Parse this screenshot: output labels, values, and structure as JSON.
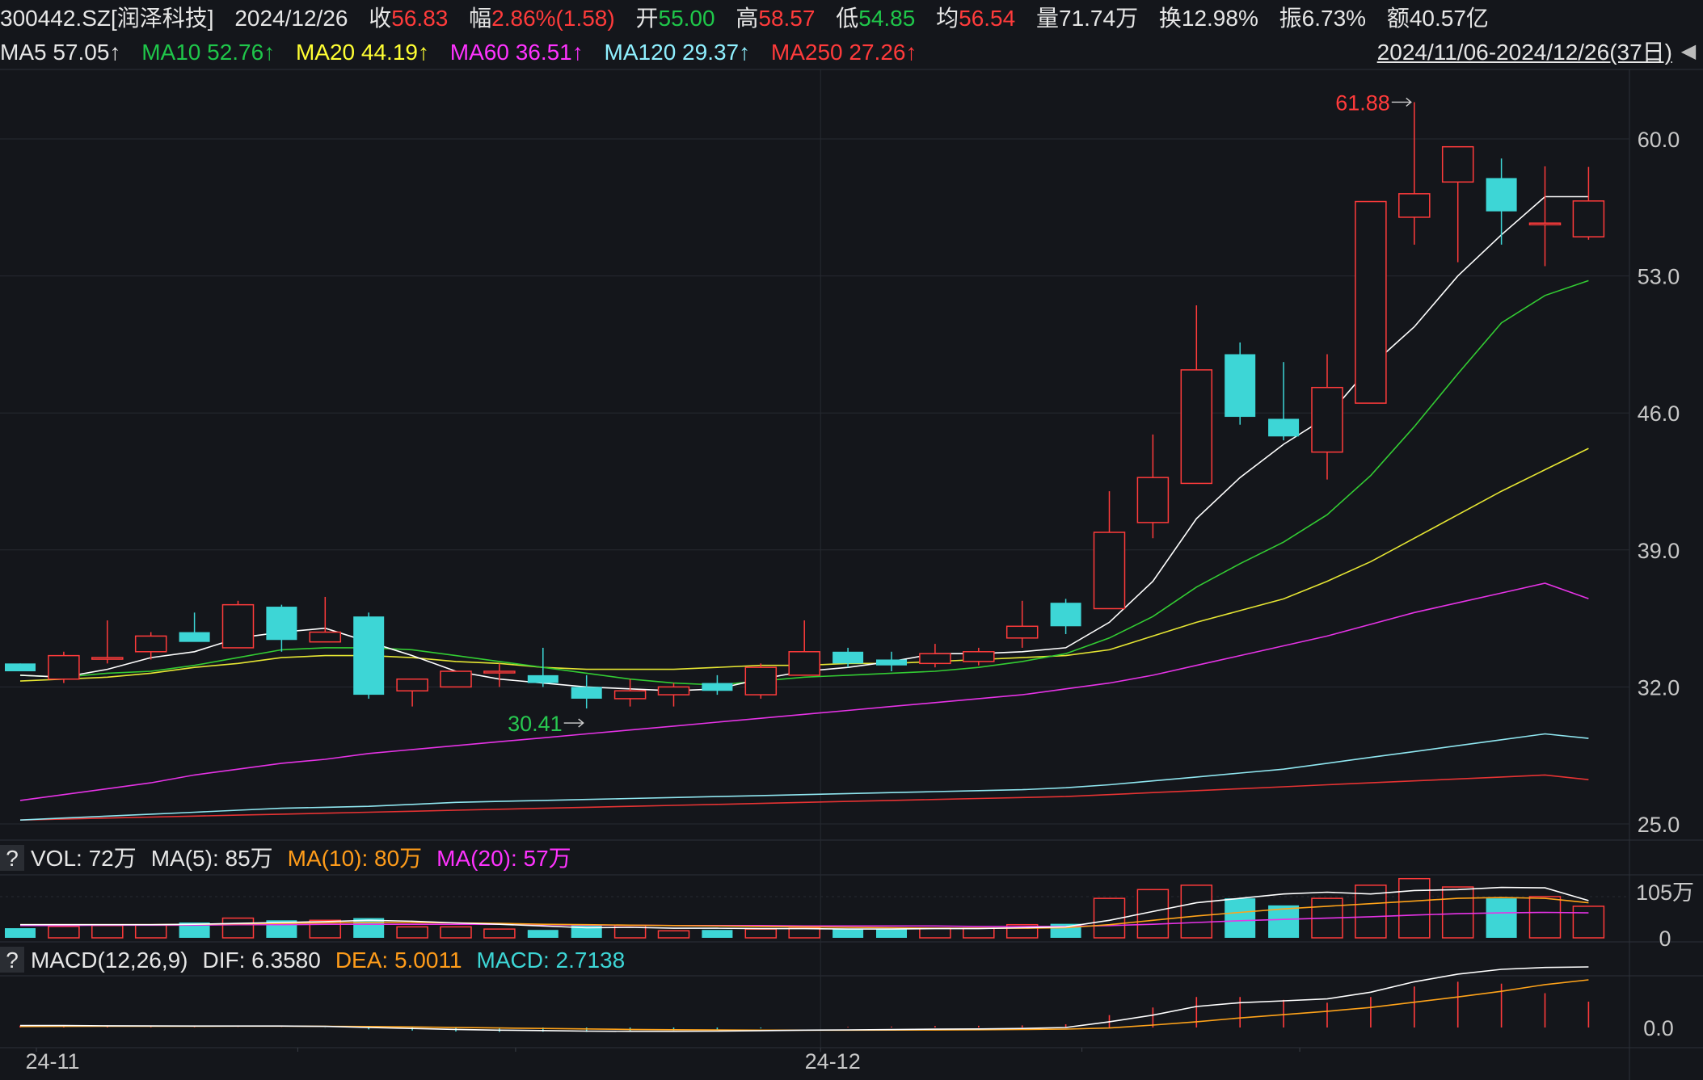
{
  "header": {
    "symbol": "300442.SZ[润泽科技]",
    "date": "2024/12/26",
    "close_label": "收",
    "close_value": "56.83",
    "change_label": "幅",
    "change_value": "2.86%(1.58)",
    "open_label": "开",
    "open_value": "55.00",
    "high_label": "高",
    "high_value": "58.57",
    "low_label": "低",
    "low_value": "54.85",
    "avg_label": "均",
    "avg_value": "56.54",
    "volume_label": "量",
    "volume_value": "71.74万",
    "turnover_label": "换",
    "turnover_value": "12.98%",
    "amplitude_label": "振",
    "amplitude_value": "6.73%",
    "amount_label": "额",
    "amount_value": "40.57亿"
  },
  "ma_legend": {
    "ma5": "MA5 57.05↑",
    "ma10": "MA10 52.76↑",
    "ma20": "MA20 44.19↑",
    "ma60": "MA60 36.51↑",
    "ma120": "MA120 29.37↑",
    "ma250": "MA250 27.26↑"
  },
  "range_label": "2024/11/06-2024/12/26(37日)",
  "range_button_icon": "triangle-left-icon",
  "vol_legend": {
    "question": "?",
    "vol": "VOL: 72万",
    "ma5": "MA(5): 85万",
    "ma10": "MA(10): 80万",
    "ma20": "MA(20): 57万"
  },
  "macd_legend": {
    "question": "?",
    "name": "MACD(12,26,9)",
    "dif": "DIF: 6.3580",
    "dea": "DEA: 5.0011",
    "macd": "MACD: 2.7138"
  },
  "colors": {
    "background": "#14161b",
    "up": "#ff3b3b",
    "down": "#3dd6d6",
    "ma5": "#ffffff",
    "ma10": "#33cc33",
    "ma20": "#e6e633",
    "ma60": "#e633e6",
    "ma120": "#8fe6f0",
    "ma250": "#e63333",
    "dif": "#ffffff",
    "dea": "#ffa31a"
  },
  "chart_data": {
    "type": "candlestick",
    "price_axis": {
      "ticks": [
        "60.0",
        "53.0",
        "46.0",
        "39.0",
        "32.0",
        "25.0"
      ]
    },
    "volume_axis": {
      "ticks": [
        "105万",
        "0"
      ]
    },
    "macd_axis": {
      "ticks": [
        "0.0"
      ]
    },
    "x_ticks": [
      "24-11",
      "24-12"
    ],
    "annotations": {
      "high": "61.88",
      "low": "30.41"
    },
    "candles": [
      {
        "o": 33.2,
        "h": 33.2,
        "l": 32.8,
        "c": 32.8
      },
      {
        "o": 32.4,
        "h": 33.8,
        "l": 32.2,
        "c": 33.6
      },
      {
        "o": 33.5,
        "h": 35.4,
        "l": 33.2,
        "c": 33.5
      },
      {
        "o": 33.8,
        "h": 34.8,
        "l": 33.4,
        "c": 34.6
      },
      {
        "o": 34.8,
        "h": 35.8,
        "l": 34.4,
        "c": 34.3
      },
      {
        "o": 34.0,
        "h": 36.4,
        "l": 34.0,
        "c": 36.2
      },
      {
        "o": 36.1,
        "h": 36.2,
        "l": 33.8,
        "c": 34.4
      },
      {
        "o": 34.3,
        "h": 36.6,
        "l": 34.3,
        "c": 34.8
      },
      {
        "o": 35.6,
        "h": 35.8,
        "l": 31.4,
        "c": 31.6
      },
      {
        "o": 31.8,
        "h": 32.4,
        "l": 31.0,
        "c": 32.4
      },
      {
        "o": 32.0,
        "h": 32.8,
        "l": 32.0,
        "c": 32.8
      },
      {
        "o": 32.8,
        "h": 33.2,
        "l": 32.0,
        "c": 32.8
      },
      {
        "o": 32.6,
        "h": 34.0,
        "l": 32.0,
        "c": 32.2
      },
      {
        "o": 32.0,
        "h": 32.6,
        "l": 30.9,
        "c": 31.4
      },
      {
        "o": 31.4,
        "h": 32.4,
        "l": 31.0,
        "c": 31.8
      },
      {
        "o": 31.6,
        "h": 32.2,
        "l": 31.0,
        "c": 32.0
      },
      {
        "o": 32.2,
        "h": 32.6,
        "l": 31.6,
        "c": 31.8
      },
      {
        "o": 31.6,
        "h": 33.2,
        "l": 31.4,
        "c": 33.0
      },
      {
        "o": 32.6,
        "h": 35.4,
        "l": 32.6,
        "c": 33.8
      },
      {
        "o": 33.8,
        "h": 34.0,
        "l": 33.0,
        "c": 33.2
      },
      {
        "o": 33.4,
        "h": 33.8,
        "l": 32.8,
        "c": 33.1
      },
      {
        "o": 33.2,
        "h": 34.2,
        "l": 33.0,
        "c": 33.7
      },
      {
        "o": 33.3,
        "h": 34.0,
        "l": 33.1,
        "c": 33.8
      },
      {
        "o": 34.5,
        "h": 36.4,
        "l": 34.0,
        "c": 35.1
      },
      {
        "o": 36.3,
        "h": 36.5,
        "l": 34.7,
        "c": 35.1
      },
      {
        "o": 36.0,
        "h": 42.0,
        "l": 36.0,
        "c": 39.9
      },
      {
        "o": 40.4,
        "h": 44.9,
        "l": 39.6,
        "c": 42.7
      },
      {
        "o": 42.4,
        "h": 51.5,
        "l": 42.4,
        "c": 48.2
      },
      {
        "o": 49.0,
        "h": 49.6,
        "l": 45.4,
        "c": 45.8
      },
      {
        "o": 45.7,
        "h": 48.6,
        "l": 44.6,
        "c": 44.8
      },
      {
        "o": 44.0,
        "h": 49.0,
        "l": 42.6,
        "c": 47.3
      },
      {
        "o": 46.5,
        "h": 56.8,
        "l": 46.5,
        "c": 56.8
      },
      {
        "o": 56.0,
        "h": 61.88,
        "l": 54.6,
        "c": 57.2
      },
      {
        "o": 57.8,
        "h": 59.4,
        "l": 53.7,
        "c": 59.6
      },
      {
        "o": 58.0,
        "h": 59.0,
        "l": 54.6,
        "c": 56.3
      },
      {
        "o": 55.7,
        "h": 58.6,
        "l": 53.5,
        "c": 55.7
      },
      {
        "o": 55.0,
        "h": 58.57,
        "l": 54.85,
        "c": 56.83
      }
    ],
    "ma5": [
      32.6,
      32.5,
      32.9,
      33.5,
      33.8,
      34.5,
      34.8,
      35.0,
      34.3,
      33.6,
      32.8,
      32.4,
      32.2,
      32.0,
      31.9,
      31.8,
      31.9,
      32.4,
      32.8,
      33.0,
      33.3,
      33.7,
      33.7,
      33.8,
      34.0,
      35.3,
      37.4,
      40.6,
      42.7,
      44.4,
      45.8,
      48.4,
      50.4,
      53.0,
      55.1,
      57.05,
      57.05
    ],
    "ma10": [
      32.6,
      32.5,
      32.7,
      32.8,
      33.1,
      33.5,
      33.9,
      34.0,
      34.0,
      33.9,
      33.6,
      33.3,
      33.0,
      32.7,
      32.4,
      32.2,
      32.1,
      32.3,
      32.5,
      32.6,
      32.7,
      32.8,
      33.0,
      33.3,
      33.7,
      34.5,
      35.6,
      37.1,
      38.3,
      39.4,
      40.8,
      42.8,
      45.3,
      48.0,
      50.6,
      52.0,
      52.76
    ],
    "ma20": [
      32.3,
      32.4,
      32.5,
      32.7,
      33.0,
      33.2,
      33.5,
      33.6,
      33.6,
      33.5,
      33.3,
      33.2,
      33.0,
      32.9,
      32.9,
      32.9,
      33.0,
      33.1,
      33.1,
      33.2,
      33.2,
      33.3,
      33.4,
      33.5,
      33.6,
      33.9,
      34.6,
      35.3,
      35.9,
      36.5,
      37.4,
      38.4,
      39.6,
      40.8,
      42.0,
      43.1,
      44.19
    ],
    "ma60": [
      26.2,
      26.5,
      26.8,
      27.1,
      27.5,
      27.8,
      28.1,
      28.3,
      28.6,
      28.8,
      29.0,
      29.2,
      29.4,
      29.6,
      29.8,
      30.0,
      30.2,
      30.4,
      30.6,
      30.8,
      31.0,
      31.2,
      31.4,
      31.6,
      31.9,
      32.2,
      32.6,
      33.1,
      33.6,
      34.1,
      34.6,
      35.2,
      35.8,
      36.3,
      36.8,
      37.3,
      36.51
    ],
    "ma120": [
      25.2,
      25.3,
      25.4,
      25.5,
      25.6,
      25.7,
      25.8,
      25.85,
      25.9,
      26.0,
      26.1,
      26.15,
      26.2,
      26.25,
      26.3,
      26.35,
      26.4,
      26.45,
      26.5,
      26.55,
      26.6,
      26.65,
      26.7,
      26.75,
      26.85,
      27.0,
      27.2,
      27.4,
      27.6,
      27.8,
      28.1,
      28.4,
      28.7,
      29.0,
      29.3,
      29.6,
      29.37
    ],
    "ma250": [
      25.2,
      25.25,
      25.3,
      25.35,
      25.4,
      25.45,
      25.5,
      25.55,
      25.6,
      25.65,
      25.7,
      25.75,
      25.8,
      25.85,
      25.9,
      25.95,
      26.0,
      26.05,
      26.1,
      26.15,
      26.2,
      26.25,
      26.3,
      26.35,
      26.4,
      26.5,
      26.6,
      26.7,
      26.8,
      26.9,
      27.0,
      27.1,
      27.2,
      27.3,
      27.4,
      27.5,
      27.26
    ],
    "volume": [
      22,
      26,
      28,
      30,
      35,
      45,
      40,
      40,
      45,
      25,
      25,
      20,
      18,
      30,
      28,
      16,
      18,
      20,
      22,
      20,
      20,
      22,
      22,
      30,
      32,
      90,
      110,
      120,
      90,
      74,
      90,
      120,
      135,
      116,
      90,
      94,
      72
    ],
    "vol_ma5": [
      30,
      30,
      30,
      30,
      31,
      33,
      35,
      37,
      40,
      38,
      34,
      31,
      27,
      23,
      24,
      22,
      22,
      21,
      21,
      20,
      20,
      21,
      21,
      23,
      25,
      40,
      60,
      80,
      90,
      100,
      104,
      100,
      108,
      110,
      115,
      114,
      85
    ],
    "vol_ma10": [
      30,
      30,
      30,
      30,
      31,
      32,
      33,
      34,
      35,
      35,
      34,
      33,
      31,
      30,
      29,
      28,
      27,
      26,
      25,
      24,
      23,
      22,
      22,
      22,
      23,
      30,
      40,
      50,
      58,
      66,
      72,
      78,
      84,
      90,
      92,
      90,
      80
    ],
    "vol_ma20": [
      28,
      28,
      29,
      29,
      29,
      30,
      30,
      31,
      31,
      31,
      31,
      31,
      30,
      29,
      29,
      28,
      28,
      28,
      27,
      27,
      27,
      27,
      26,
      26,
      26,
      28,
      31,
      35,
      39,
      42,
      45,
      48,
      52,
      55,
      57,
      58,
      57
    ],
    "dif": [
      0.2,
      0.2,
      0.18,
      0.16,
      0.15,
      0.15,
      0.15,
      0.12,
      0.0,
      -0.1,
      -0.2,
      -0.28,
      -0.32,
      -0.38,
      -0.4,
      -0.4,
      -0.38,
      -0.33,
      -0.28,
      -0.25,
      -0.22,
      -0.18,
      -0.15,
      -0.1,
      0.0,
      0.6,
      1.3,
      2.2,
      2.6,
      2.8,
      3.0,
      3.7,
      4.8,
      5.6,
      6.1,
      6.3,
      6.358
    ],
    "dea": [
      0.1,
      0.12,
      0.13,
      0.13,
      0.13,
      0.14,
      0.14,
      0.13,
      0.1,
      0.06,
      0.01,
      -0.05,
      -0.1,
      -0.15,
      -0.2,
      -0.24,
      -0.26,
      -0.28,
      -0.28,
      -0.28,
      -0.27,
      -0.26,
      -0.24,
      -0.21,
      -0.17,
      -0.05,
      0.25,
      0.6,
      1.0,
      1.35,
      1.7,
      2.1,
      2.65,
      3.2,
      3.8,
      4.5,
      5.0011
    ],
    "macd_bar": [
      0.2,
      0.16,
      0.1,
      0.06,
      0.04,
      0.02,
      0.02,
      -0.02,
      -0.2,
      -0.32,
      -0.42,
      -0.46,
      -0.44,
      -0.46,
      -0.4,
      -0.32,
      -0.24,
      -0.1,
      0.0,
      0.06,
      0.1,
      0.16,
      0.18,
      0.22,
      0.34,
      1.3,
      2.1,
      3.2,
      3.2,
      2.9,
      2.6,
      3.2,
      4.3,
      4.8,
      4.6,
      3.6,
      2.7138
    ]
  }
}
